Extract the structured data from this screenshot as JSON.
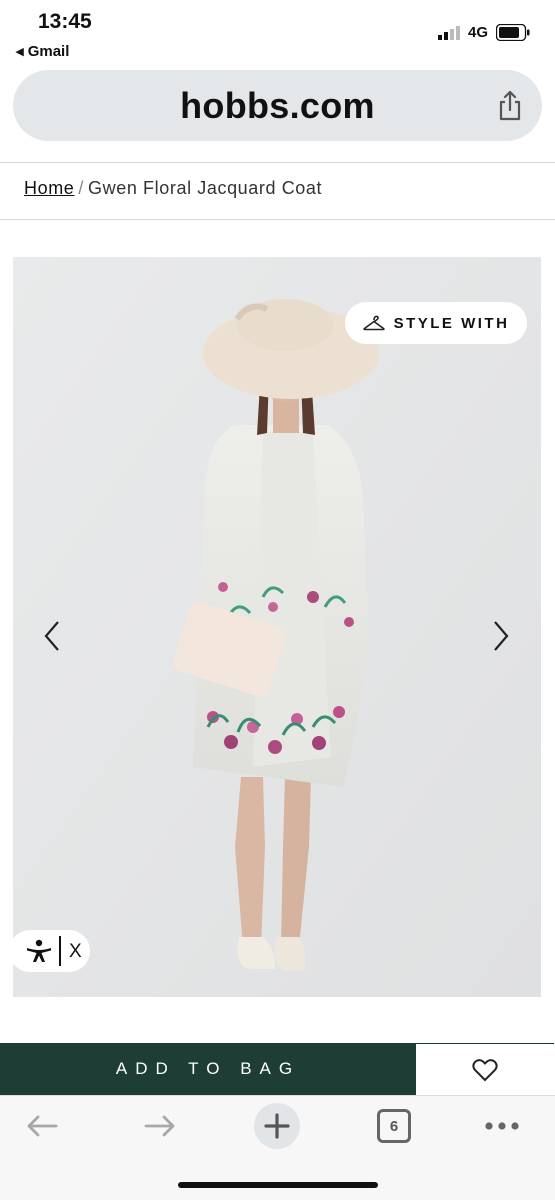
{
  "status_bar": {
    "time": "13:45",
    "back_app": "◂ Gmail",
    "network": "4G"
  },
  "browser": {
    "url": "hobbs.com",
    "tab_count": "6"
  },
  "breadcrumb": {
    "home": "Home",
    "separator": "/",
    "current": "Gwen Floral Jacquard Coat"
  },
  "product_image": {
    "style_with_label": "STYLE WITH",
    "accessibility_close": "X"
  },
  "purchase": {
    "add_to_bag_label": "ADD TO BAG"
  },
  "colors": {
    "accent_green": "#1e3d35",
    "url_bar": "#e3e7ea",
    "image_bg": "#e6e7e8"
  }
}
